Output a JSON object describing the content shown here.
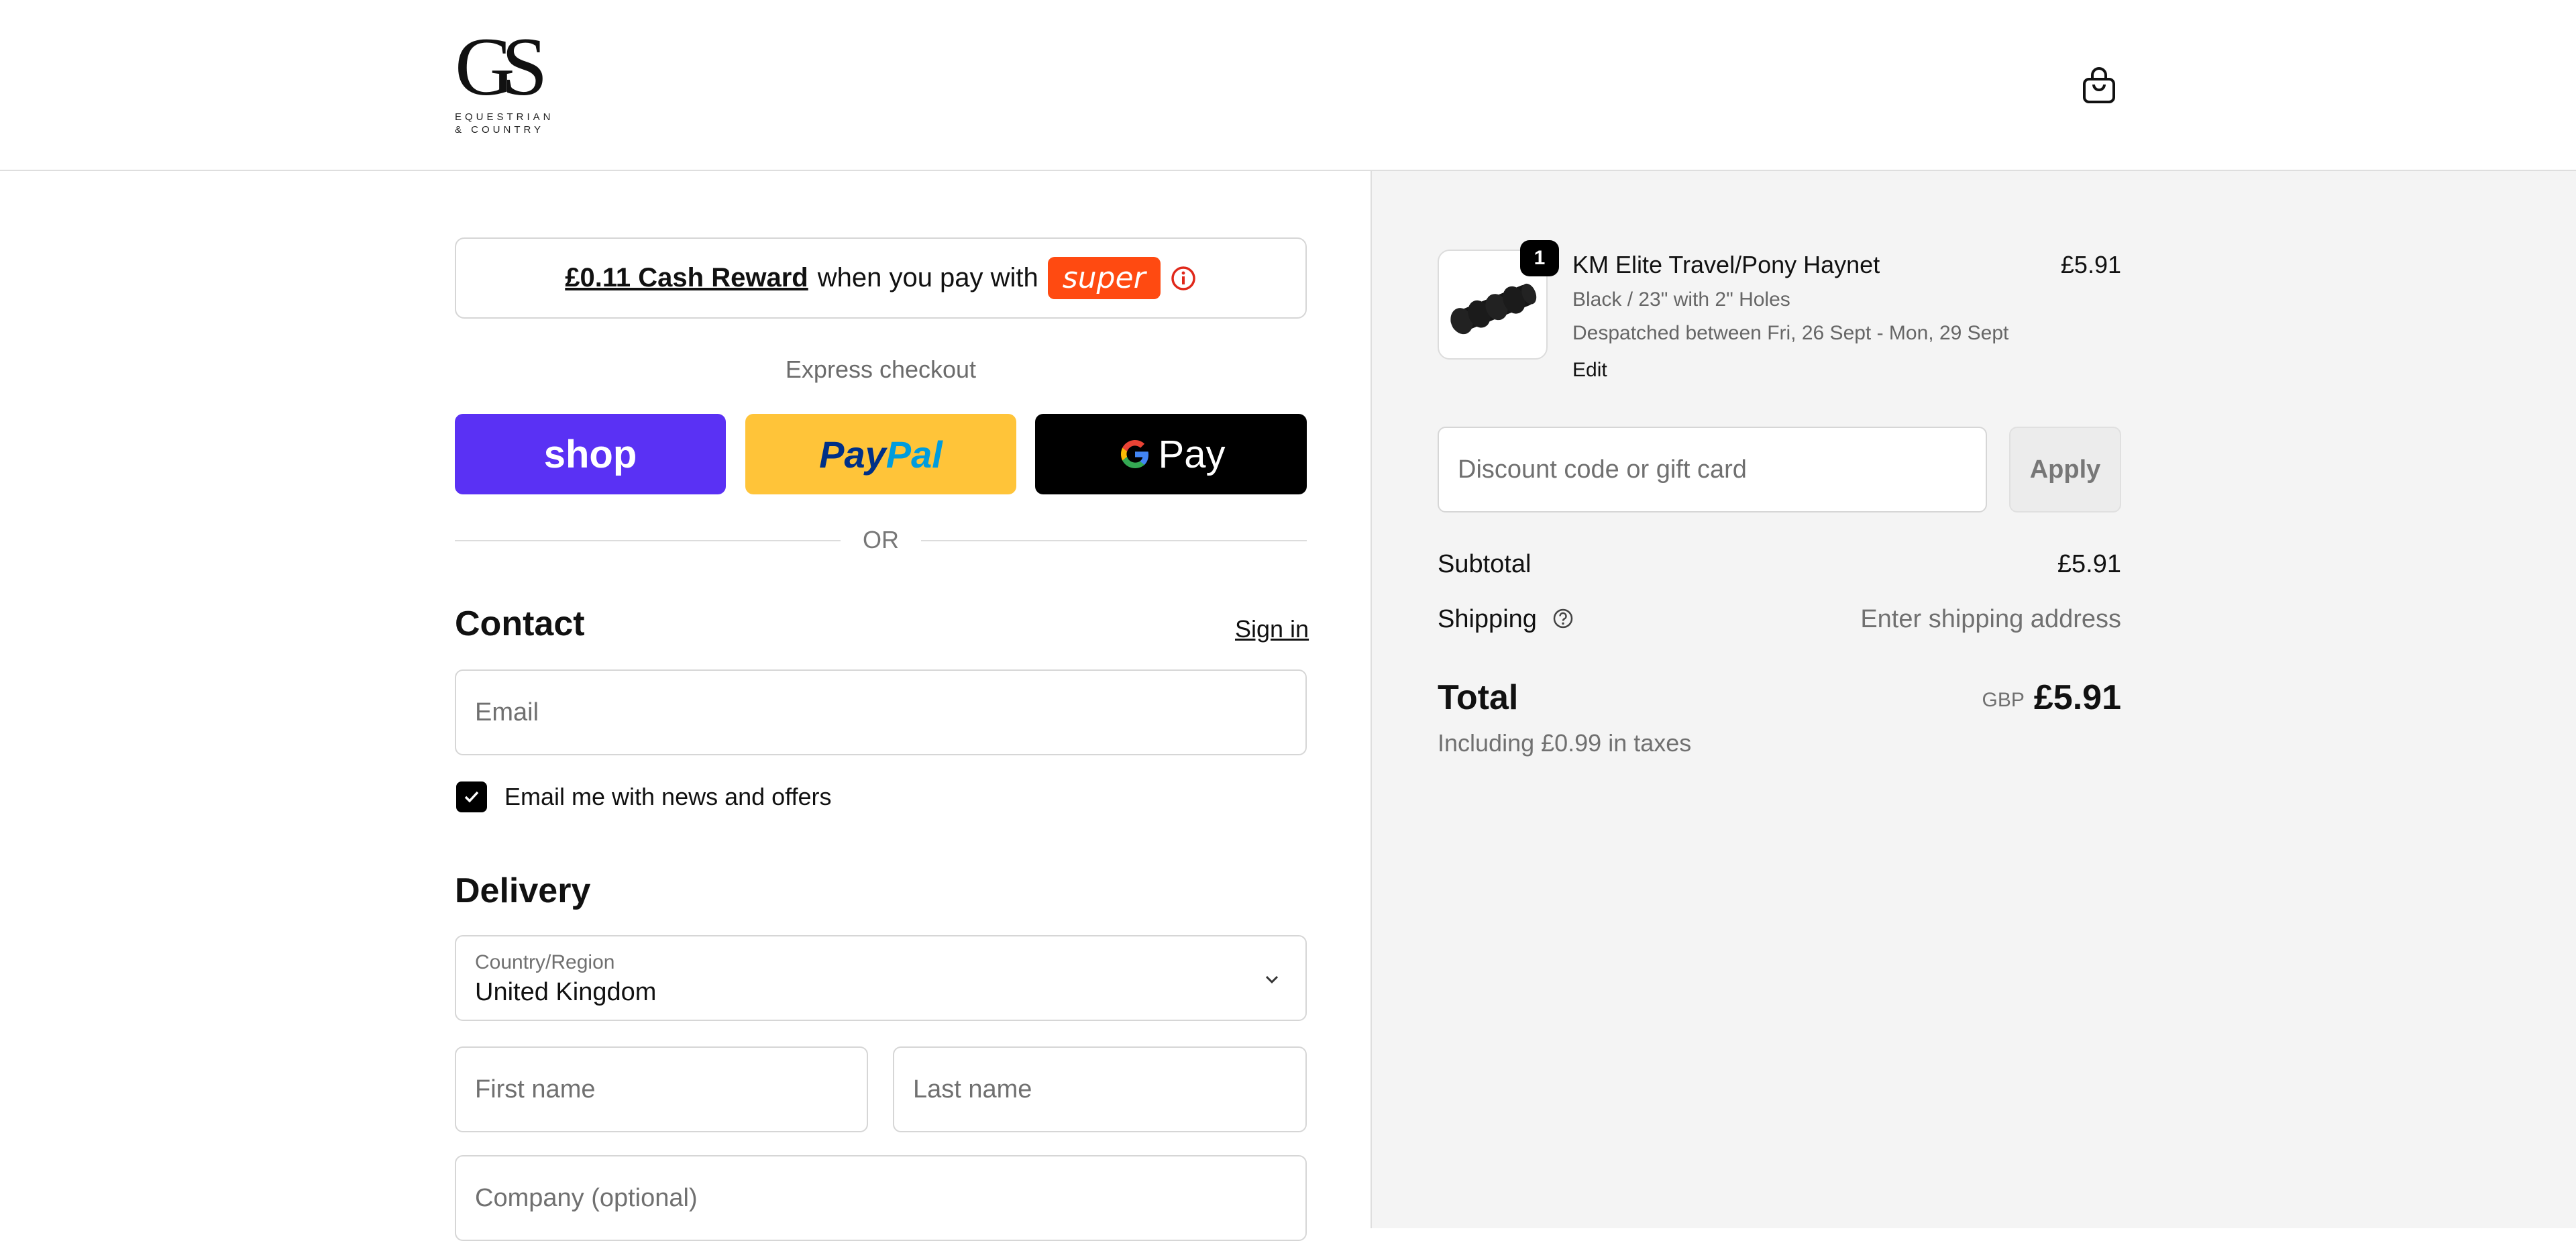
{
  "brand": {
    "monogram": "GS",
    "line1": "EQUESTRIAN",
    "line2": "& COUNTRY"
  },
  "header": {
    "cart_icon": "shopping-bag-icon"
  },
  "reward": {
    "amount": "£0.11 Cash Reward",
    "text": "when you pay with",
    "partner": "super"
  },
  "express": {
    "label": "Express checkout",
    "shop_label": "shop",
    "paypal_label_1": "Pay",
    "paypal_label_2": "Pal",
    "gpay_label": "Pay",
    "or_label": "OR"
  },
  "contact": {
    "title": "Contact",
    "signin_label": "Sign in",
    "email_placeholder": "Email",
    "newsletter_label": "Email me with news and offers",
    "newsletter_checked": true
  },
  "delivery": {
    "title": "Delivery",
    "country_label": "Country/Region",
    "country_value": "United Kingdom",
    "first_name_placeholder": "First name",
    "last_name_placeholder": "Last name",
    "company_placeholder": "Company (optional)"
  },
  "order": {
    "item": {
      "quantity": "1",
      "name": "KM Elite Travel/Pony Haynet",
      "variant": "Black / 23\" with 2\" Holes",
      "dispatch": "Despatched between Fri, 26 Sept - Mon, 29 Sept",
      "edit_label": "Edit",
      "price": "£5.91"
    },
    "discount_placeholder": "Discount code or gift card",
    "apply_label": "Apply",
    "subtotal_label": "Subtotal",
    "subtotal_value": "£5.91",
    "shipping_label": "Shipping",
    "shipping_value": "Enter shipping address",
    "total_label": "Total",
    "total_currency": "GBP",
    "total_value": "£5.91",
    "tax_note": "Including £0.99 in taxes"
  },
  "colors": {
    "shop_purple": "#5a31f4",
    "paypal_yellow": "#ffc439",
    "super_orange": "#ff4a11",
    "summary_bg": "#f4f4f4"
  }
}
